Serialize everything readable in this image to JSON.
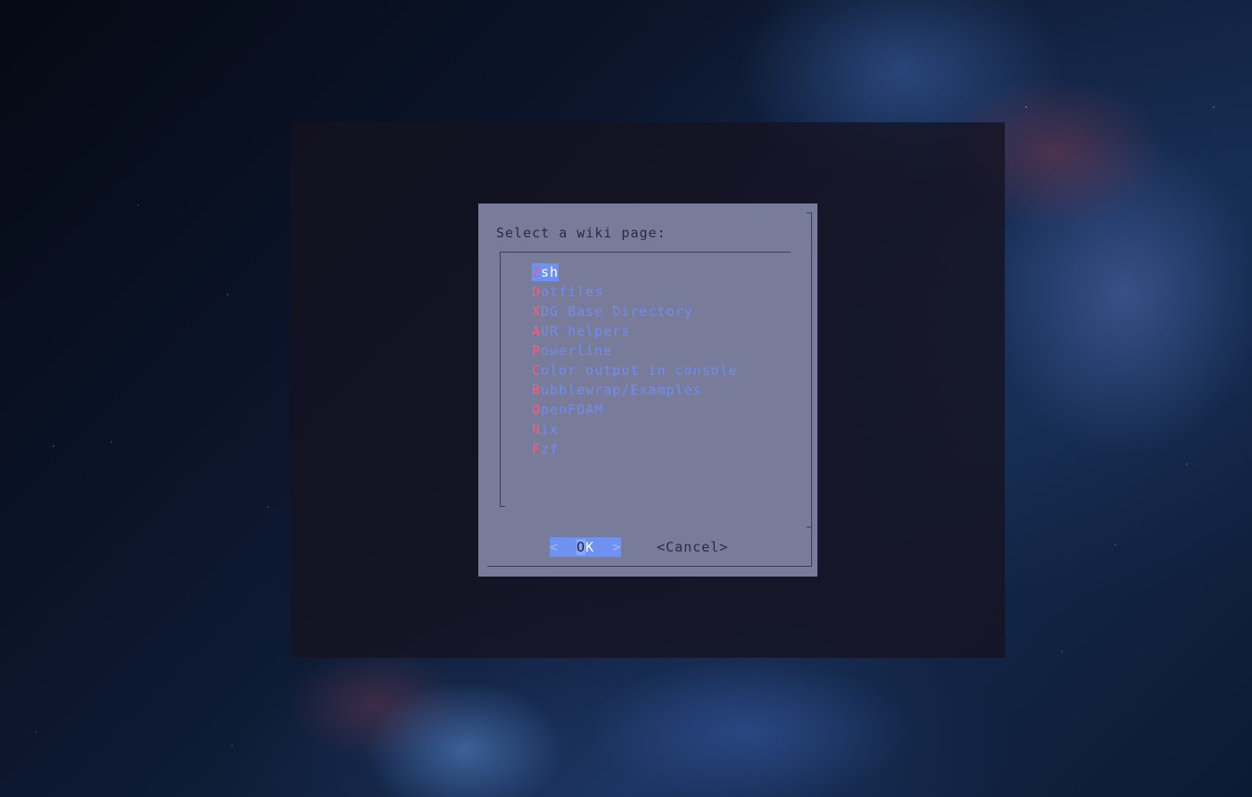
{
  "dialog": {
    "prompt": "Select a wiki page:",
    "items": [
      {
        "hotkey": "Z",
        "rest": "sh",
        "selected": true
      },
      {
        "hotkey": "D",
        "rest": "otfiles",
        "selected": false
      },
      {
        "hotkey": "X",
        "rest": "DG Base Directory",
        "selected": false
      },
      {
        "hotkey": "A",
        "rest": "UR helpers",
        "selected": false
      },
      {
        "hotkey": "P",
        "rest": "owerline",
        "selected": false
      },
      {
        "hotkey": "C",
        "rest": "olor output in console",
        "selected": false
      },
      {
        "hotkey": "B",
        "rest": "ubblewrap/Examples",
        "selected": false
      },
      {
        "hotkey": "O",
        "rest": "penFOAM",
        "selected": false
      },
      {
        "hotkey": "N",
        "rest": "ix",
        "selected": false
      },
      {
        "hotkey": "F",
        "rest": "zf",
        "selected": false
      }
    ],
    "ok_button": {
      "left": "<  ",
      "o": "O",
      "k": "K",
      "right": "  >"
    },
    "cancel_button": "<Cancel>"
  },
  "colors": {
    "dialog_bg": "#787b9a",
    "highlight": "#6e91f2",
    "hotkey": "#ff5a78",
    "item_text": "#6f8ef0"
  }
}
